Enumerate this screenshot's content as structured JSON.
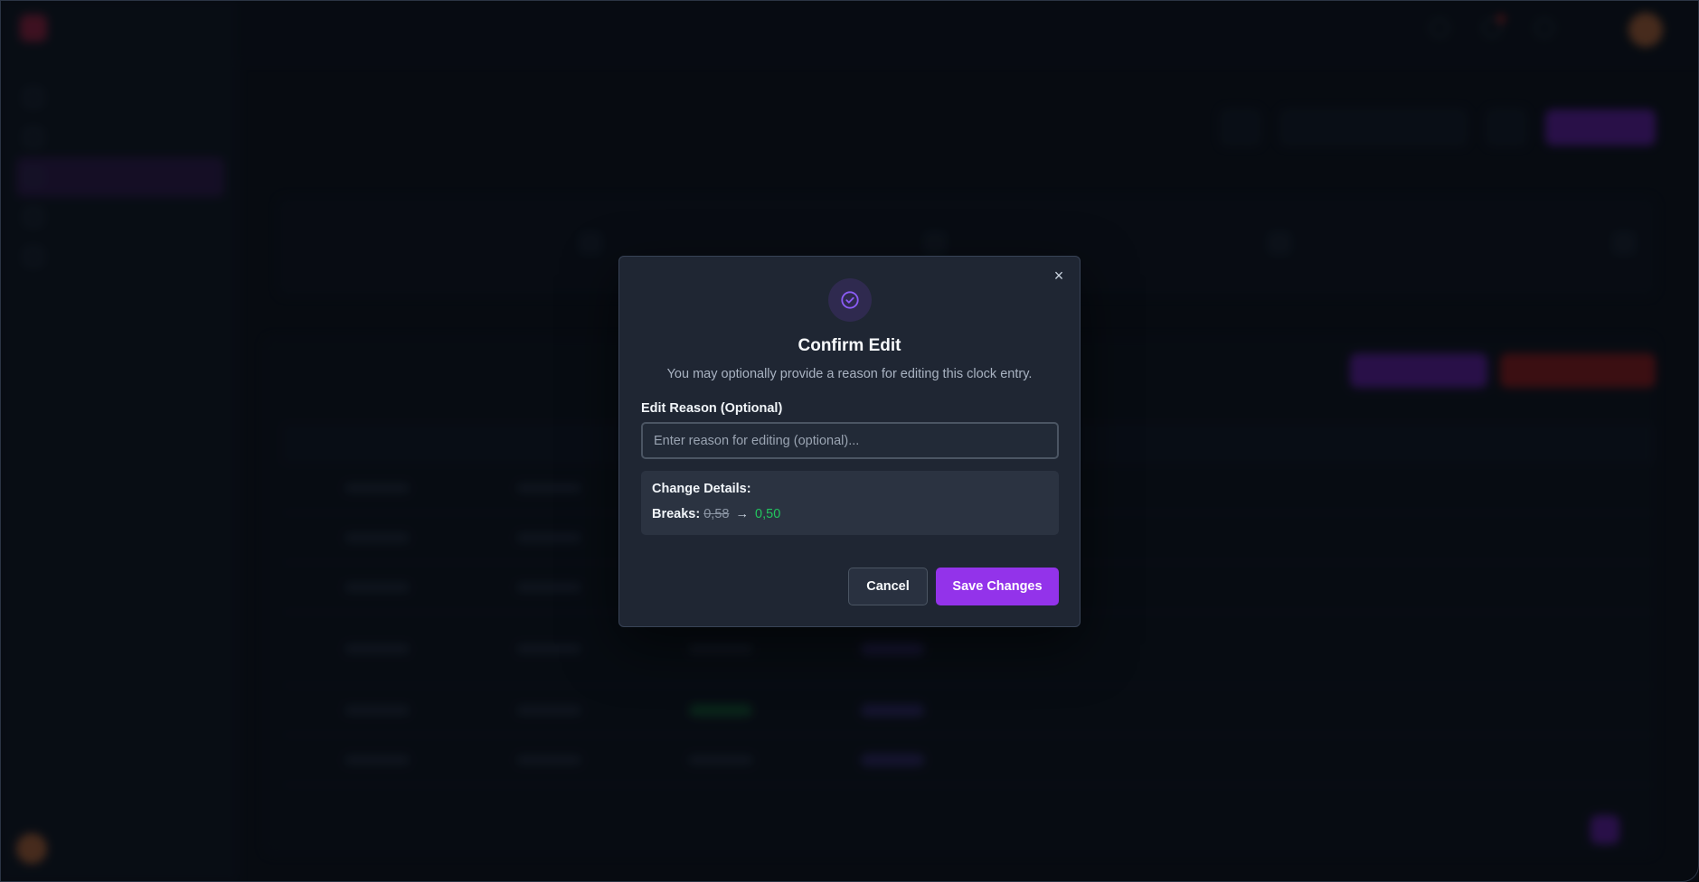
{
  "modal": {
    "title": "Confirm Edit",
    "description": "You may optionally provide a reason for editing this clock entry.",
    "reason_label": "Edit Reason (Optional)",
    "reason_placeholder": "Enter reason for editing (optional)...",
    "reason_value": "",
    "details_title": "Change Details:",
    "change": {
      "field_label": "Breaks:",
      "old_value": "0,58",
      "arrow": "→",
      "new_value": "0,50"
    },
    "cancel_label": "Cancel",
    "save_label": "Save Changes",
    "close_glyph": "×",
    "icon": "check-circle-icon",
    "colors": {
      "accent": "#9333ea",
      "success": "#22c55e",
      "icon_stroke": "#8b5cf6"
    }
  },
  "background": {
    "blurred": true
  }
}
